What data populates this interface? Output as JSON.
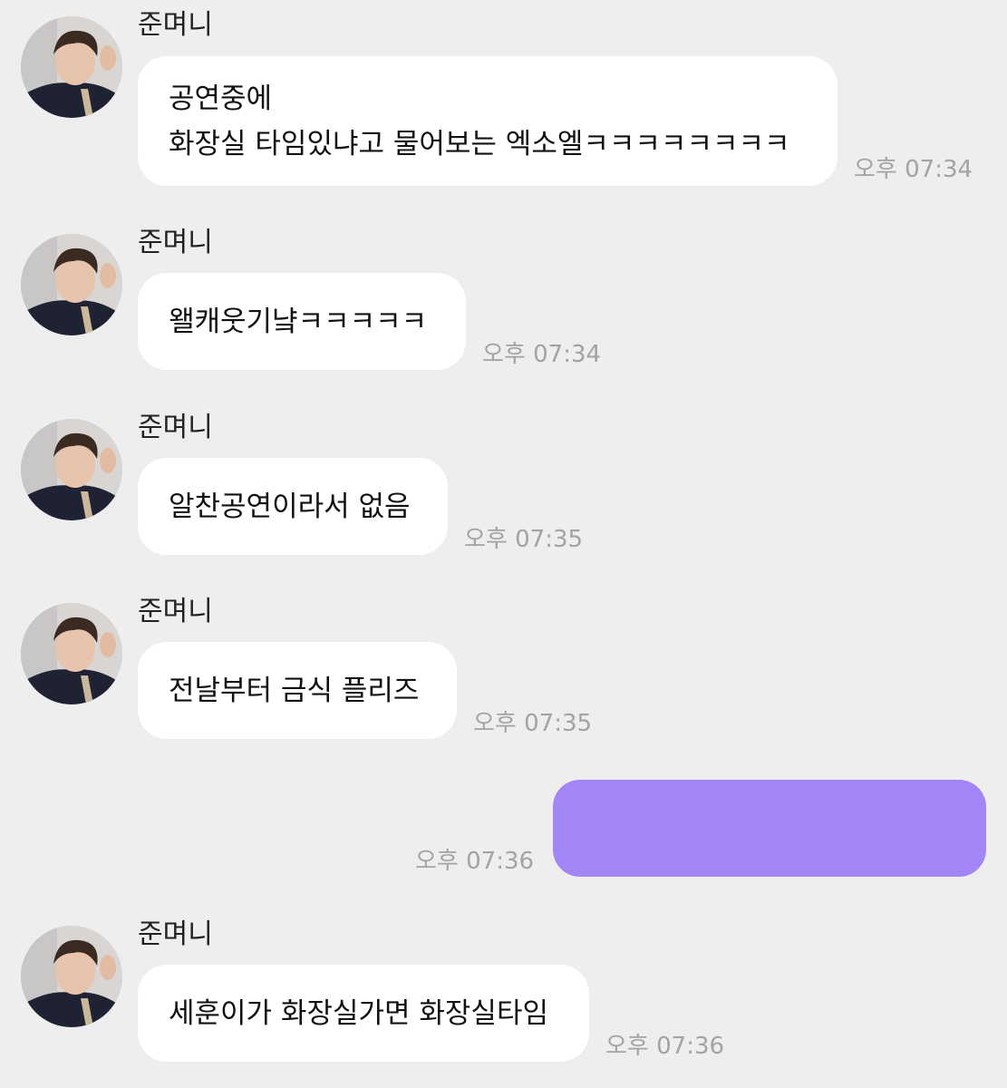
{
  "messages": [
    {
      "sender": "준며니",
      "lines": [
        "공연중에",
        "화장실 타임있냐고 물어보는 엑소엘ㅋㅋㅋㅋㅋㅋㅋㅋ"
      ],
      "time": "오후 07:34"
    },
    {
      "sender": "준며니",
      "lines": [
        "왤캐웃기냨ㅋㅋㅋㅋㅋ"
      ],
      "time": "오후 07:34"
    },
    {
      "sender": "준며니",
      "lines": [
        "알찬공연이라서 없음"
      ],
      "time": "오후 07:35"
    },
    {
      "sender": "준며니",
      "lines": [
        "전날부터 금식 플리즈"
      ],
      "time": "오후 07:35"
    },
    {
      "time": "오후 07:36",
      "bubble_color": "#a385f7"
    },
    {
      "sender": "준며니",
      "lines": [
        "세훈이가 화장실가면 화장실타임"
      ],
      "time": "오후 07:36"
    }
  ],
  "colors": {
    "background": "#eeeeee",
    "bubble": "#ffffff",
    "my_bubble": "#a385f7",
    "time_text": "#a3a3a3"
  },
  "icons": {
    "avatar": "profile-photo"
  }
}
